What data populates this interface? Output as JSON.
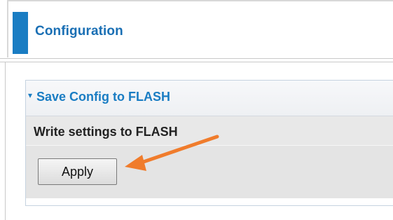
{
  "header": {
    "title": "Configuration"
  },
  "panel": {
    "toggle_icon": "▾",
    "title": "Save Config to FLASH",
    "description": "Write settings to FLASH",
    "apply_label": "Apply"
  },
  "colors": {
    "accent": "#1a7dc3",
    "annotation_arrow": "#f07c2c"
  }
}
